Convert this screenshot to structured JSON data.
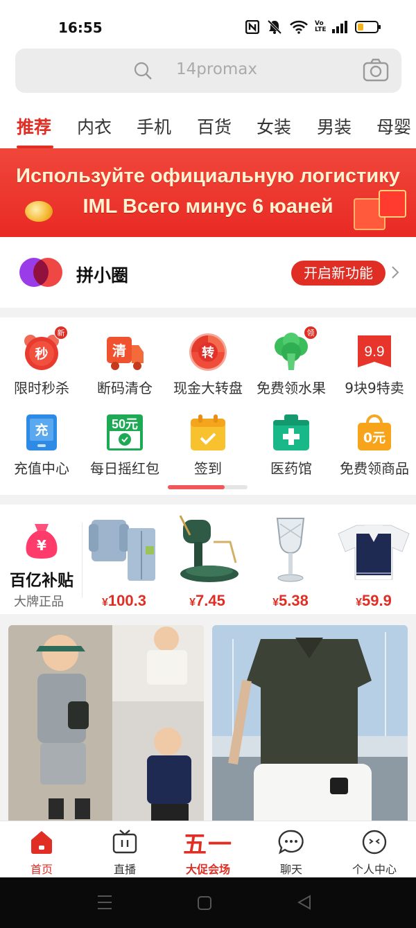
{
  "status_bar": {
    "time": "16:55",
    "icons": [
      "nfc-icon",
      "mute-icon",
      "wifi-icon",
      "volte-icon",
      "signal-icon",
      "battery-icon"
    ],
    "volte_text": "Vo LTE"
  },
  "search": {
    "placeholder": "14promax",
    "icons": [
      "search-icon",
      "camera-icon"
    ]
  },
  "tabs": [
    {
      "label": "推荐",
      "active": true
    },
    {
      "label": "内衣"
    },
    {
      "label": "手机"
    },
    {
      "label": "百货"
    },
    {
      "label": "女装"
    },
    {
      "label": "男装"
    },
    {
      "label": "母婴"
    }
  ],
  "banner": {
    "line1": "Используйте официальную логистику",
    "line2": "IML Всего минус 6 юаней"
  },
  "pinxiaoquan": {
    "title": "拼小圈",
    "button": "开启新功能"
  },
  "grid": {
    "items": [
      {
        "label": "限时秒杀",
        "icon": "alarm-clock-icon",
        "icon_text": "秒",
        "badge": "新"
      },
      {
        "label": "断码清仓",
        "icon": "truck-icon",
        "icon_text": "清"
      },
      {
        "label": "现金大转盘",
        "icon": "wheel-icon",
        "icon_text": "转"
      },
      {
        "label": "免费领水果",
        "icon": "broccoli-icon",
        "badge": "领"
      },
      {
        "label": "9块9特卖",
        "icon": "price-tag-icon",
        "icon_text": "9.9"
      },
      {
        "label": "充值中心",
        "icon": "phone-topup-icon",
        "icon_text": "充"
      },
      {
        "label": "每日摇红包",
        "icon": "red-packet-icon",
        "icon_text": "50元"
      },
      {
        "label": "签到",
        "icon": "calendar-check-icon"
      },
      {
        "label": "医药馆",
        "icon": "medicine-kit-icon"
      },
      {
        "label": "免费领商品",
        "icon": "shopping-bag-icon",
        "icon_text": "0元"
      }
    ],
    "scroll_progress": 0.71
  },
  "subsidy": {
    "title": "百亿补贴",
    "subtitle": "大牌正品",
    "bag_symbol": "¥",
    "currency": "¥",
    "products": [
      {
        "price": "100.3",
        "image": "kids-denim-set"
      },
      {
        "price": "7.45",
        "image": "fruit-peeler"
      },
      {
        "price": "5.38",
        "image": "crystal-goblet"
      },
      {
        "price": "59.9",
        "image": "school-vest-shirt"
      }
    ]
  },
  "feed": {
    "cards": [
      {
        "image": "kids-fashion-photo"
      },
      {
        "image": "mens-polo-photo"
      }
    ]
  },
  "bottom_nav": {
    "items": [
      {
        "label": "首页",
        "icon": "home-icon",
        "active": true
      },
      {
        "label": "直播",
        "icon": "tv-icon"
      },
      {
        "label": "大促会场",
        "icon_text": "五一"
      },
      {
        "label": "聊天",
        "icon": "chat-icon"
      },
      {
        "label": "个人中心",
        "icon": "profile-icon"
      }
    ]
  },
  "system_nav": [
    "menu-icon",
    "home-square-icon",
    "back-icon"
  ],
  "colors": {
    "accent": "#e02e24",
    "banner": "#ea2f27",
    "status_bg": "#ffffff"
  }
}
